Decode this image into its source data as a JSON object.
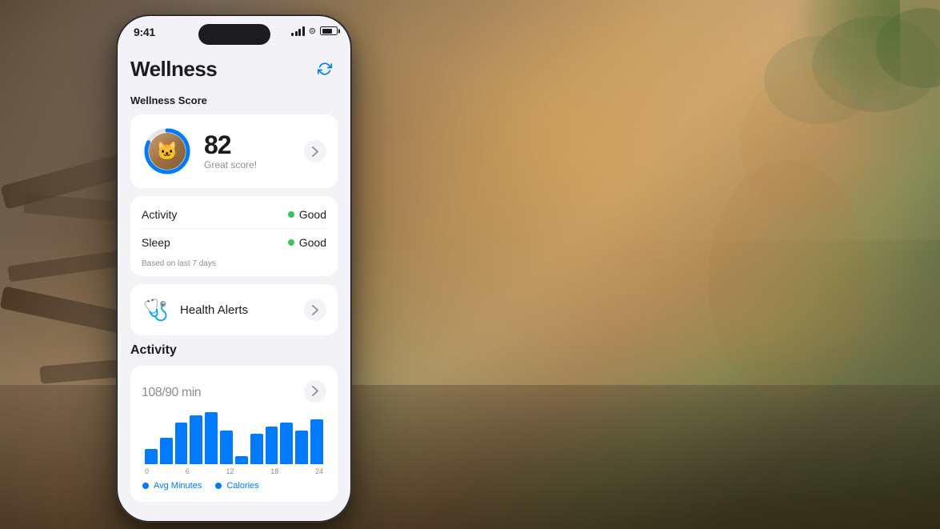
{
  "background": {
    "description": "Outdoor nature background with cat and wooden debris"
  },
  "phone": {
    "status_bar": {
      "time": "9:41",
      "signal_label": "signal",
      "wifi_label": "wifi",
      "battery_label": "battery"
    },
    "header": {
      "title": "Wellness",
      "refresh_label": "refresh"
    },
    "wellness_score": {
      "section_label": "Wellness Score",
      "score": "82",
      "score_description": "Great score!",
      "chevron": "›"
    },
    "stats": {
      "rows": [
        {
          "name": "Activity",
          "status": "Good",
          "dot_color": "#34c759"
        },
        {
          "name": "Sleep",
          "status": "Good",
          "dot_color": "#34c759"
        }
      ],
      "footnote": "Based on last 7 days"
    },
    "health_alerts": {
      "title": "Health Alerts",
      "icon": "🩺",
      "chevron": "›"
    },
    "activity": {
      "section_label": "Activity",
      "value": "108",
      "unit": "/90 min",
      "chevron": "›",
      "chart": {
        "bars": [
          {
            "height": 20,
            "label": "0"
          },
          {
            "height": 35,
            "label": ""
          },
          {
            "height": 55,
            "label": ""
          },
          {
            "height": 65,
            "label": "6"
          },
          {
            "height": 70,
            "label": ""
          },
          {
            "height": 45,
            "label": "12"
          },
          {
            "height": 10,
            "label": ""
          },
          {
            "height": 40,
            "label": ""
          },
          {
            "height": 50,
            "label": "18"
          },
          {
            "height": 55,
            "label": ""
          },
          {
            "height": 45,
            "label": ""
          },
          {
            "height": 60,
            "label": "24"
          }
        ],
        "x_labels": [
          "0",
          "6",
          "12",
          "18",
          "24"
        ]
      },
      "legend": [
        {
          "label": "Avg Minutes",
          "color": "#007aff"
        },
        {
          "label": "Calories",
          "color": "#007aff"
        }
      ]
    }
  }
}
